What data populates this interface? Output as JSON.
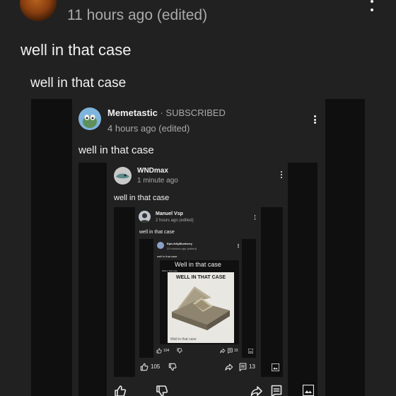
{
  "l0": {
    "time": "11 hours ago (edited)",
    "comment": "well in that case"
  },
  "l1": {
    "text": "well in that case"
  },
  "l2": {
    "author": "Memetastic",
    "separator": "·",
    "subscribed": "SUBSCRIBED",
    "time": "4 hours ago (edited)",
    "text": "well in that case"
  },
  "l3": {
    "author": "WNDmax",
    "time": "1 minute ago",
    "text": "well in that case"
  },
  "l4": {
    "author": "Manuel Vsp",
    "time": "2 hours ago (edited)",
    "text": "well in that case",
    "likes": "105",
    "comments": "13"
  },
  "l5": {
    "author": "EpicJellyBlueberry",
    "time": "23 minutes ago (edited)",
    "text": "well in that case",
    "likes": "104",
    "comments": "33"
  },
  "l6": {
    "caption": "Well in that case",
    "small_caption": "Well in that case",
    "meme_title": "WELL IN THAT CASE",
    "bottom_caption": "Well in that case"
  },
  "colors": {
    "background": "#212121",
    "strip": "#0f0f0f",
    "text": "#f1f1f1",
    "meta": "#aaaaaa"
  },
  "icons": [
    "kebab-icon",
    "like-icon",
    "dislike-icon",
    "share-icon",
    "comment-icon",
    "image-icon"
  ]
}
